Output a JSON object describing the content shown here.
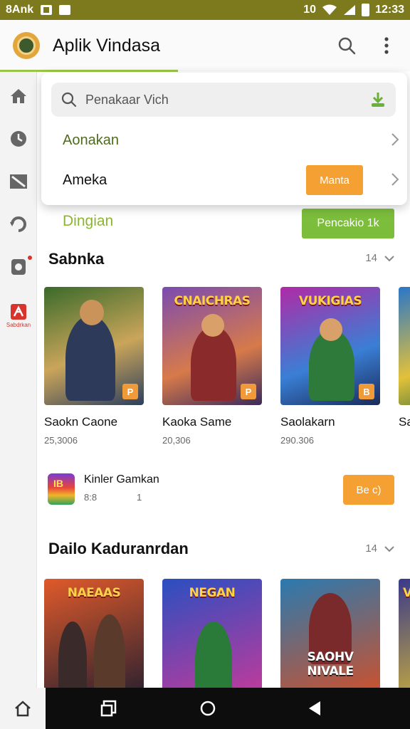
{
  "status_bar": {
    "left_text": "8Ank",
    "time": "12:33",
    "right_text": "10"
  },
  "app_bar": {
    "title": "Aplik Vindasa",
    "icons": [
      "search-icon",
      "more-vert-icon"
    ]
  },
  "side_rail": {
    "items": [
      {
        "icon": "home-icon"
      },
      {
        "icon": "clock-icon"
      },
      {
        "icon": "image-icon"
      },
      {
        "icon": "refresh-icon"
      },
      {
        "icon": "tablet-icon"
      },
      {
        "icon": "app-icon",
        "label": "Sabdrkan"
      }
    ]
  },
  "popover": {
    "search_placeholder": "Penakaar Vich",
    "rows": [
      {
        "label": "Aonakan",
        "color": "#4f6b1e"
      },
      {
        "label": "Ameka",
        "color": "#111111",
        "button": "Manta"
      }
    ]
  },
  "promo_row": {
    "label": "Dingian",
    "button": "Pencakio 1k"
  },
  "section1": {
    "title": "Sabnka",
    "more": "14",
    "cards": [
      {
        "title": "Saokn Caone",
        "sub": "25,3006",
        "caption": "",
        "bg": [
          "#3a6a2a",
          "#caa55a"
        ],
        "badge": "P"
      },
      {
        "title": "Kaoka Same",
        "sub": "20,306",
        "caption": "CNAICHRAS",
        "bg": [
          "#7b4bb0",
          "#d77a4a"
        ],
        "badge": "P"
      },
      {
        "title": "Saolakarn",
        "sub": "290.306",
        "caption": "VUKIGIAS",
        "bg": [
          "#b02aa6",
          "#3a7fd5"
        ],
        "badge": "B"
      },
      {
        "title": "Sar",
        "sub": "",
        "caption": "",
        "bg": [
          "#2a76c8",
          "#e2c13a"
        ],
        "badge": ""
      }
    ]
  },
  "list_item": {
    "icon_text": "IB",
    "title": "Kinler Gamkan",
    "sub": "8:8",
    "sub2": "1",
    "button": "Be c)"
  },
  "section2": {
    "title": "Dailo Kaduranrdan",
    "more": "14",
    "cards": [
      {
        "caption": "NAEAAS",
        "bg": [
          "#e05a2a",
          "#2a2030"
        ]
      },
      {
        "caption": "NEGAN",
        "bg": [
          "#2a4fc0",
          "#c43a9a"
        ]
      },
      {
        "caption": "SAOHV NIVALE",
        "bg": [
          "#2a7ab0",
          "#d0502a"
        ]
      },
      {
        "caption": "V",
        "bg": [
          "#3a3a8a",
          "#e0c030"
        ]
      }
    ]
  },
  "accent_colors": {
    "status_bar": "#7d7a1e",
    "green": "#7cbd3b",
    "orange": "#f5a033",
    "rail_alert": "#d9342b"
  },
  "nav_bar": {
    "icons": [
      "home-icon",
      "recents-icon",
      "home-circle-icon",
      "back-icon"
    ]
  }
}
